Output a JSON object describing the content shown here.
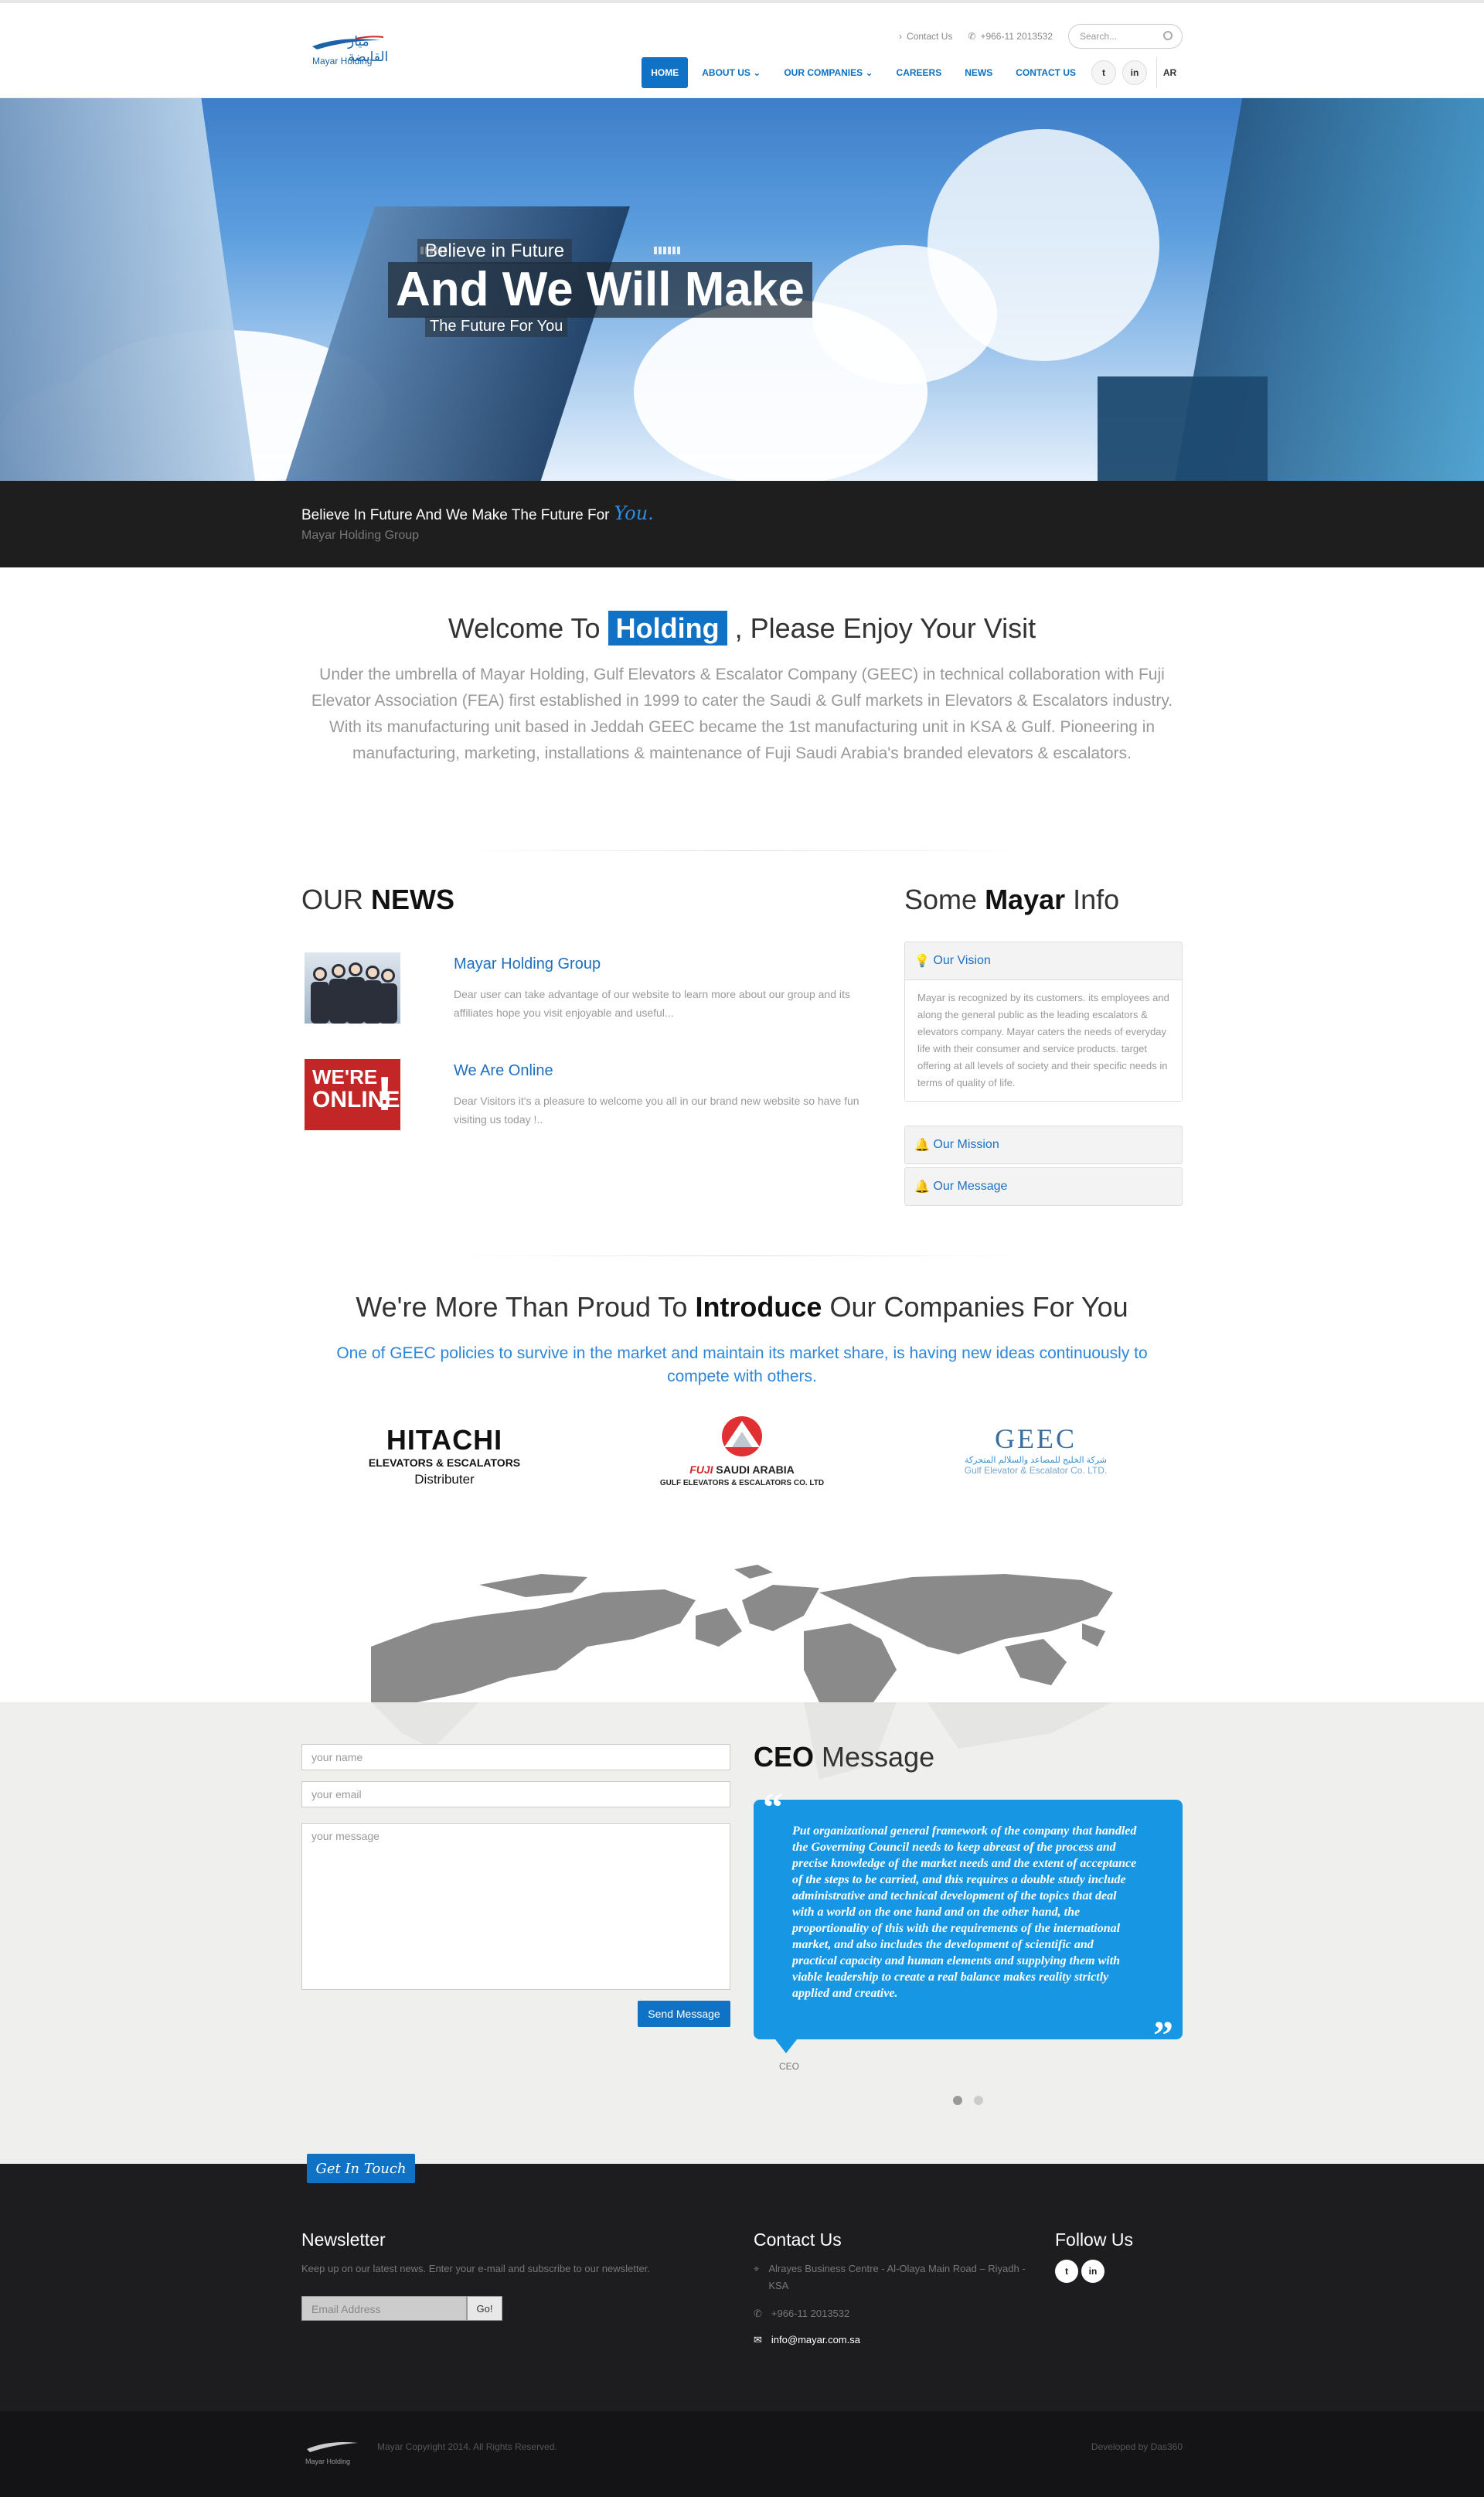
{
  "header": {
    "logo_ar": "ميار القابضة",
    "logo_en": "Mayar Holding",
    "contact_link": "Contact Us",
    "phone": "+966-11 2013532",
    "search_placeholder": "Search...",
    "nav": [
      "HOME",
      "ABOUT US",
      "OUR COMPANIES",
      "CAREERS",
      "NEWS",
      "CONTACT US"
    ],
    "social": [
      "twitter-icon",
      "linkedin-icon"
    ],
    "lang": "AR"
  },
  "hero": {
    "line1": "Believe in Future",
    "line2": "And We Will Make",
    "line3": "The Future For You"
  },
  "tagline": {
    "text": "Believe In Future And We Make The Future For",
    "you": "You.",
    "sub": "Mayar Holding Group"
  },
  "welcome": {
    "pre": "Welcome To",
    "highlight": "Holding",
    "post": ", Please Enjoy Your Visit",
    "body": "Under the umbrella of Mayar Holding, Gulf Elevators & Escalator Company (GEEC) in technical collaboration with Fuji Elevator Association (FEA) first established in 1999 to cater the Saudi & Gulf markets in Elevators & Escalators industry. With its manufacturing unit based in Jeddah GEEC became the 1st manufacturing unit in KSA & Gulf. Pioneering in manufacturing, marketing, installations & maintenance of Fuji Saudi Arabia's branded elevators & escalators."
  },
  "news": {
    "heading_light": "OUR",
    "heading_bold": "NEWS",
    "items": [
      {
        "title": "Mayar Holding Group",
        "body": "Dear user can take advantage of our website to learn more about our group and its affiliates hope you visit enjoyable and useful..."
      },
      {
        "title": "We Are Online",
        "body": "Dear Visitors it's a pleasure to welcome you all in our brand new website so have fun visiting us today !..",
        "badge_top": "WE'RE",
        "badge_bottom": "ONLINE",
        "badge_mark": "!"
      }
    ]
  },
  "info": {
    "heading_pre": "Some",
    "heading_bold": "Mayar",
    "heading_post": "Info",
    "panels": [
      {
        "title": "Our Vision",
        "body": "Mayar is recognized by its customers. its employees and along the general public as the leading escalators & elevators company. Mayar caters the needs of everyday life with their consumer and service products. target offering at all levels of society and their specific needs in terms of quality of life."
      },
      {
        "title": "Our Mission"
      },
      {
        "title": "Our Message"
      }
    ]
  },
  "companies": {
    "heading_pre": "We're More Than Proud To",
    "heading_bold": "Introduce",
    "heading_post": "Our Companies For You",
    "sub": "One of GEEC policies to survive in the market and maintain its market share, is having new ideas continuously to compete with others.",
    "hitachi": {
      "name": "HITACHI",
      "line2": "ELEVATORS & ESCALATORS",
      "line3": "Distributer"
    },
    "fuji": {
      "name": "FUJI",
      "name2": "SAUDI ARABIA",
      "line2": "GULF ELEVATORS & ESCALATORS CO. LTD"
    },
    "geec": {
      "name": "GEEC",
      "line_ar": "شركة الخليج للمصاعد والسلالم المتحركة",
      "line2": "Gulf Elevator & Escalator Co. LTD."
    }
  },
  "contact_form": {
    "name_placeholder": "your name",
    "email_placeholder": "your email",
    "message_placeholder": "your message",
    "submit": "Send Message"
  },
  "ceo": {
    "heading_bold": "CEO",
    "heading_light": "Message",
    "quote": "Put organizational general framework of the company that handled the Governing Council needs to keep abreast of the process and precise knowledge of the market needs and the extent of acceptance of the steps to be carried, and this requires a double study include administrative and technical development of the topics that deal with a world on the one hand and on the other hand, the proportionality of this with the requirements of the international market, and also includes the development of scientific and practical capacity and human elements and supplying them with viable leadership to create a real balance makes reality strictly applied and creative.",
    "author": "CEO"
  },
  "footer": {
    "get_in_touch": "Get In Touch",
    "newsletter_title": "Newsletter",
    "newsletter_text": "Keep up on our latest news. Enter your e-mail and subscribe to our newsletter.",
    "email_placeholder": "Email Address",
    "go": "Go!",
    "contact_title": "Contact Us",
    "address": "Alrayes Business Centre - Al-Olaya Main Road – Riyadh - KSA",
    "phone": "+966-11 2013532",
    "email": "info@mayar.com.sa",
    "follow_title": "Follow Us",
    "copyright": "Mayar Copyright 2014. All Rights Reserved.",
    "developed": "Developed by Das360"
  }
}
